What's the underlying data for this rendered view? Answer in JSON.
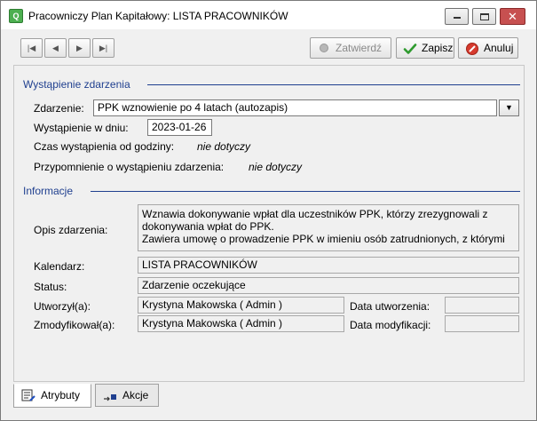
{
  "window": {
    "title": "Pracowniczy Plan Kapitałowy:  LISTA PRACOWNIKÓW",
    "app_icon_text": "Q"
  },
  "toolbar": {
    "confirm_label": "Zatwierdź",
    "save_label": "Zapisz",
    "cancel_label": "Anuluj"
  },
  "occurrence": {
    "section_title": "Wystąpienie zdarzenia",
    "event_label": "Zdarzenie:",
    "event_value": "PPK wznowienie po 4 latach (autozapis)",
    "date_label": "Wystąpienie w dniu:",
    "date_value": "2023-01-26",
    "time_label": "Czas wystąpienia od godziny:",
    "time_value": "nie dotyczy",
    "reminder_label": "Przypomnienie o wystąpieniu zdarzenia:",
    "reminder_value": "nie dotyczy"
  },
  "info": {
    "section_title": "Informacje",
    "description_label": "Opis zdarzenia:",
    "description_lines": [
      "Wznawia dokonywanie wpłat dla uczestników PPK, którzy zrezygnowali z",
      "dokonywania wpłat do PPK.",
      "Zawiera umowę o prowadzenie PPK w imieniu osób zatrudnionych, z którymi"
    ],
    "calendar_label": "Kalendarz:",
    "calendar_value": "LISTA PRACOWNIKÓW",
    "status_label": "Status:",
    "status_value": "Zdarzenie oczekujące",
    "created_by_label": "Utworzył(a):",
    "created_by_value": "Krystyna Makowska ( Admin )",
    "created_date_label": "Data utworzenia:",
    "created_date_value": "",
    "modified_by_label": "Zmodyfikował(a):",
    "modified_by_value": "Krystyna Makowska ( Admin )",
    "modified_date_label": "Data modyfikacji:",
    "modified_date_value": ""
  },
  "tabs": [
    {
      "label": "Atrybuty",
      "active": true
    },
    {
      "label": "Akcje",
      "active": false
    }
  ],
  "colors": {
    "section_accent": "#1f3f8f",
    "save_check": "#2e9a2e",
    "cancel_red": "#d63a2e"
  }
}
